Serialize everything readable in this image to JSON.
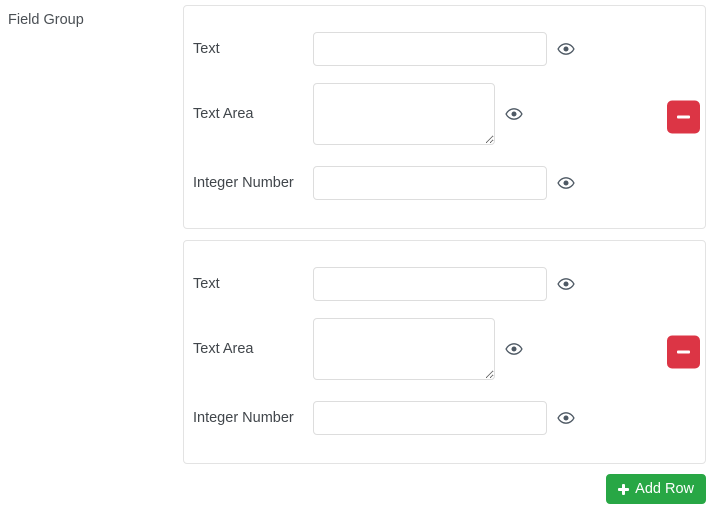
{
  "group": {
    "label": "Field Group"
  },
  "rows": [
    {
      "fields": [
        {
          "type": "text",
          "label": "Text",
          "value": "",
          "placeholder": "",
          "toggle_icon": "eye-icon"
        },
        {
          "type": "textarea",
          "label": "Text Area",
          "value": "",
          "placeholder": "",
          "toggle_icon": "eye-icon"
        },
        {
          "type": "number",
          "label": "Integer Number",
          "value": "",
          "placeholder": "",
          "toggle_icon": "eye-icon"
        }
      ],
      "remove_label": "",
      "remove_icon": "minus-icon"
    },
    {
      "fields": [
        {
          "type": "text",
          "label": "Text",
          "value": "",
          "placeholder": "",
          "toggle_icon": "eye-icon"
        },
        {
          "type": "textarea",
          "label": "Text Area",
          "value": "",
          "placeholder": "",
          "toggle_icon": "eye-icon"
        },
        {
          "type": "number",
          "label": "Integer Number",
          "value": "",
          "placeholder": "",
          "toggle_icon": "eye-icon"
        }
      ],
      "remove_label": "",
      "remove_icon": "minus-icon"
    }
  ],
  "footer": {
    "add_label": "Add Row",
    "add_icon": "plus-icon"
  },
  "colors": {
    "remove_button": "#dc3545",
    "add_button": "#28a745",
    "panel_border": "#e3e3e3",
    "input_border": "#dddddd",
    "text": "#41464b",
    "background": "#ffffff"
  }
}
